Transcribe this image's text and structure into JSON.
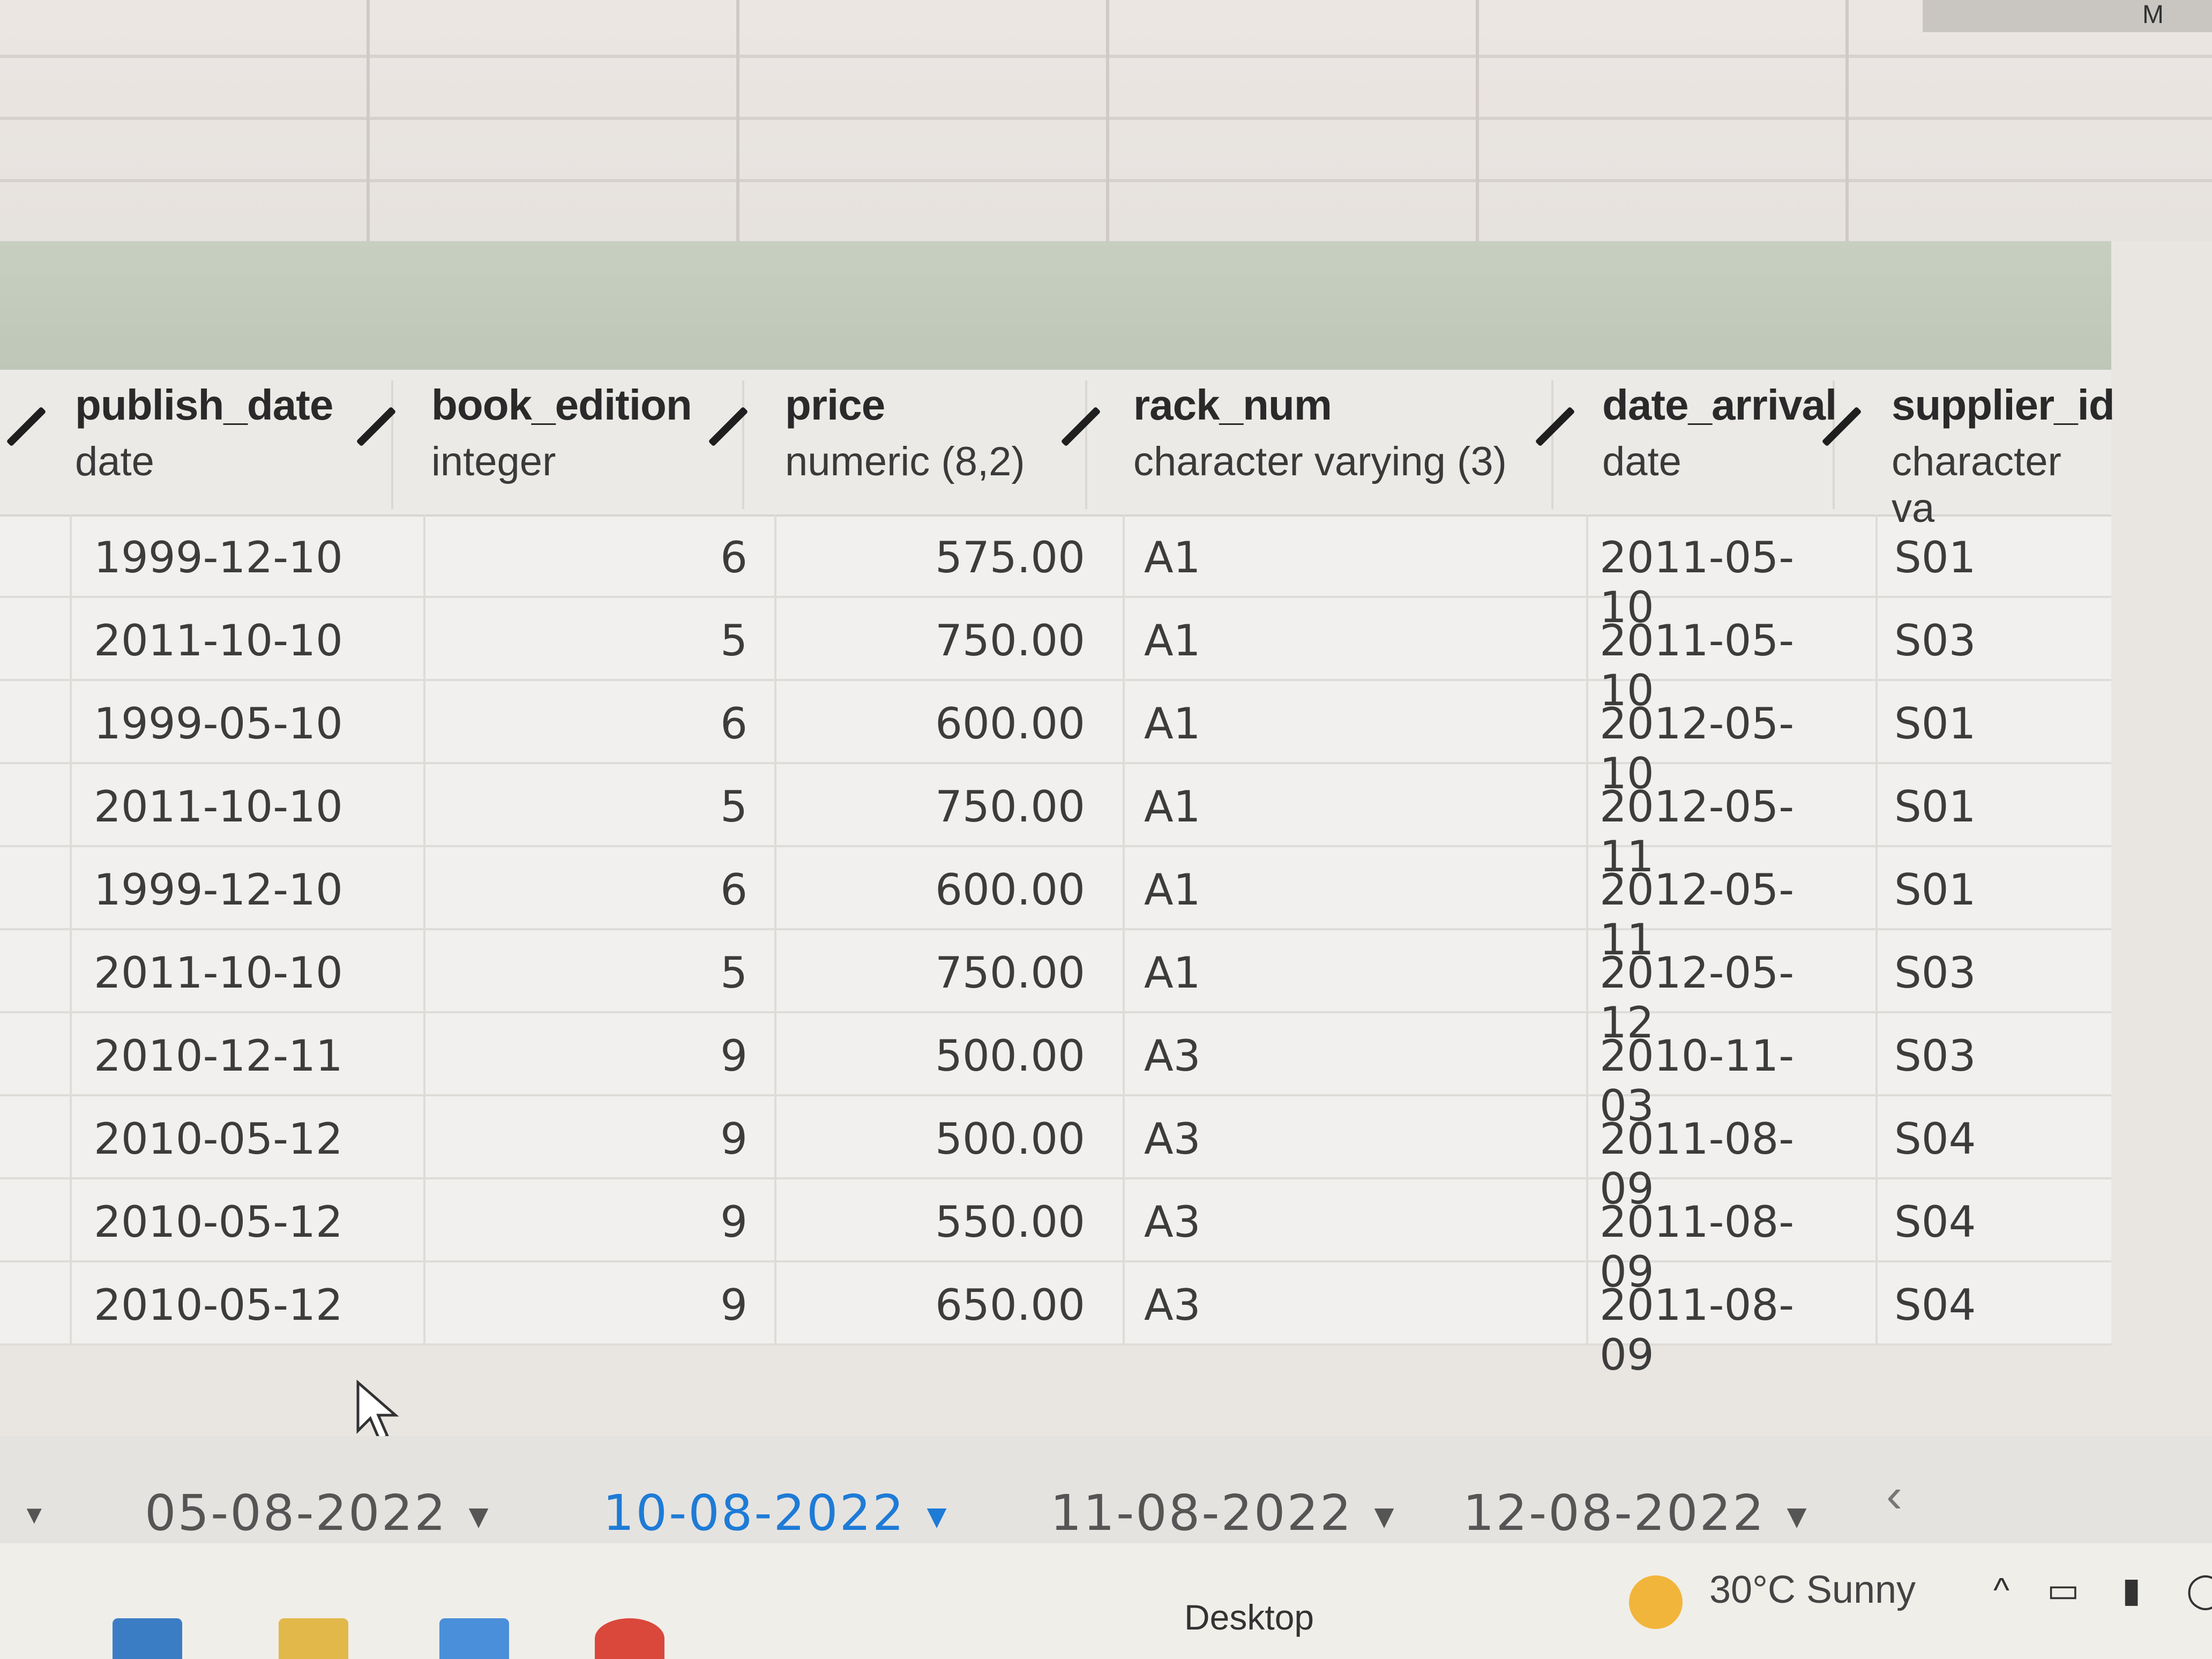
{
  "sheet": {
    "corner_text": "M"
  },
  "columns": [
    {
      "name": "publish_date",
      "type": "date"
    },
    {
      "name": "book_edition",
      "type": "integer"
    },
    {
      "name": "price",
      "type": "numeric (8,2)"
    },
    {
      "name": "rack_num",
      "type": "character varying (3)"
    },
    {
      "name": "date_arrival",
      "type": "date"
    },
    {
      "name": "supplier_id",
      "type": "character va"
    }
  ],
  "rows": [
    [
      "1999-12-10",
      "6",
      "575.00",
      "A1",
      "2011-05-10",
      "S01"
    ],
    [
      "2011-10-10",
      "5",
      "750.00",
      "A1",
      "2011-05-10",
      "S03"
    ],
    [
      "1999-05-10",
      "6",
      "600.00",
      "A1",
      "2012-05-10",
      "S01"
    ],
    [
      "2011-10-10",
      "5",
      "750.00",
      "A1",
      "2012-05-11",
      "S01"
    ],
    [
      "1999-12-10",
      "6",
      "600.00",
      "A1",
      "2012-05-11",
      "S01"
    ],
    [
      "2011-10-10",
      "5",
      "750.00",
      "A1",
      "2012-05-12",
      "S03"
    ],
    [
      "2010-12-11",
      "9",
      "500.00",
      "A3",
      "2010-11-03",
      "S03"
    ],
    [
      "2010-05-12",
      "9",
      "500.00",
      "A3",
      "2011-08-09",
      "S04"
    ],
    [
      "2010-05-12",
      "9",
      "550.00",
      "A3",
      "2011-08-09",
      "S04"
    ],
    [
      "2010-05-12",
      "9",
      "650.00",
      "A3",
      "2011-08-09",
      "S04"
    ]
  ],
  "tabs": [
    {
      "label": "05-08-2022",
      "active": false
    },
    {
      "label": "10-08-2022",
      "active": true
    },
    {
      "label": "11-08-2022",
      "active": false
    },
    {
      "label": "12-08-2022",
      "active": false
    }
  ],
  "taskbar": {
    "desktop_label": "Desktop",
    "weather": "30°C  Sunny"
  },
  "colors": {
    "active_tab": "#1e7bd6",
    "header_band": "#c7cfc1",
    "weather_sun": "#f2b53b"
  }
}
